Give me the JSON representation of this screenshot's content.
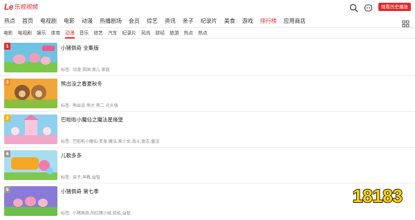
{
  "header": {
    "logo_mark": "Le",
    "logo_text": "乐视视频",
    "record_button": "观看历史播放"
  },
  "nav": {
    "items": [
      {
        "label": "热点",
        "active": false
      },
      {
        "label": "首页",
        "active": false
      },
      {
        "label": "电视剧",
        "active": false
      },
      {
        "label": "电影",
        "active": false
      },
      {
        "label": "动漫",
        "active": false
      },
      {
        "label": "热播剧场",
        "active": false
      },
      {
        "label": "会员",
        "active": false
      },
      {
        "label": "综艺",
        "active": false
      },
      {
        "label": "资讯",
        "active": false
      },
      {
        "label": "亲子",
        "active": false
      },
      {
        "label": "纪录片",
        "active": false
      },
      {
        "label": "美食",
        "active": false
      },
      {
        "label": "游戏",
        "active": false
      },
      {
        "label": "排行榜",
        "active": true
      },
      {
        "label": "应用商店",
        "active": false
      }
    ]
  },
  "subnav": {
    "items": [
      {
        "label": "电影",
        "active": false
      },
      {
        "label": "电视剧",
        "active": false
      },
      {
        "label": "娱乐",
        "active": false
      },
      {
        "label": "体育",
        "active": false
      },
      {
        "label": "动漫",
        "active": true
      },
      {
        "label": "音乐",
        "active": false
      },
      {
        "label": "综艺",
        "active": false
      },
      {
        "label": "汽车",
        "active": false
      },
      {
        "label": "纪录片",
        "active": false
      },
      {
        "label": "风尚",
        "active": false
      },
      {
        "label": "财经",
        "active": false
      },
      {
        "label": "旅游",
        "active": false
      },
      {
        "label": "热点",
        "active": false
      },
      {
        "label": "热点",
        "active": false
      }
    ]
  },
  "list": {
    "tags_label": "标签:",
    "rows": [
      {
        "rank": "1",
        "title": "小猪佩奇 全集版",
        "tags": "动漫 英国 育儿 家庭",
        "rank_color": "#e5292a",
        "thumb_bg": "#6fc3e0",
        "thumb_ground": "#7cc84a"
      },
      {
        "rank": "2",
        "title": "熊出没之春夏秋冬",
        "tags": "熊出没 熊大 熊二 光头强",
        "rank_color": "#f08c1e",
        "thumb_bg": "#f2a63a",
        "thumb_ground": "#8bbf3e"
      },
      {
        "rank": "3",
        "title": "巴啦啦小魔仙之魔法星缘堡",
        "tags": "巴啦啦小魔仙,变身,魔法,美少女,战斗,励志,童话",
        "rank_color": "#f5b300",
        "thumb_bg": "#8fd0ef",
        "thumb_ground": "#f3a7c8"
      },
      {
        "rank": "4",
        "title": "儿歌多多",
        "tags": "亲子,早教,益智",
        "rank_color": "#9a9a9a",
        "thumb_bg": "#a8dcef",
        "thumb_ground": "#7ec850"
      },
      {
        "rank": "5",
        "title": "小猪佩奇 第七季",
        "tags": "小猪佩奇,阳红猪小妹,轻松,益智",
        "rank_color": "#9a9a9a",
        "thumb_bg": "#8a7ad8",
        "thumb_ground": "#6bbf4a"
      }
    ]
  },
  "watermark": {
    "text": "18183"
  }
}
